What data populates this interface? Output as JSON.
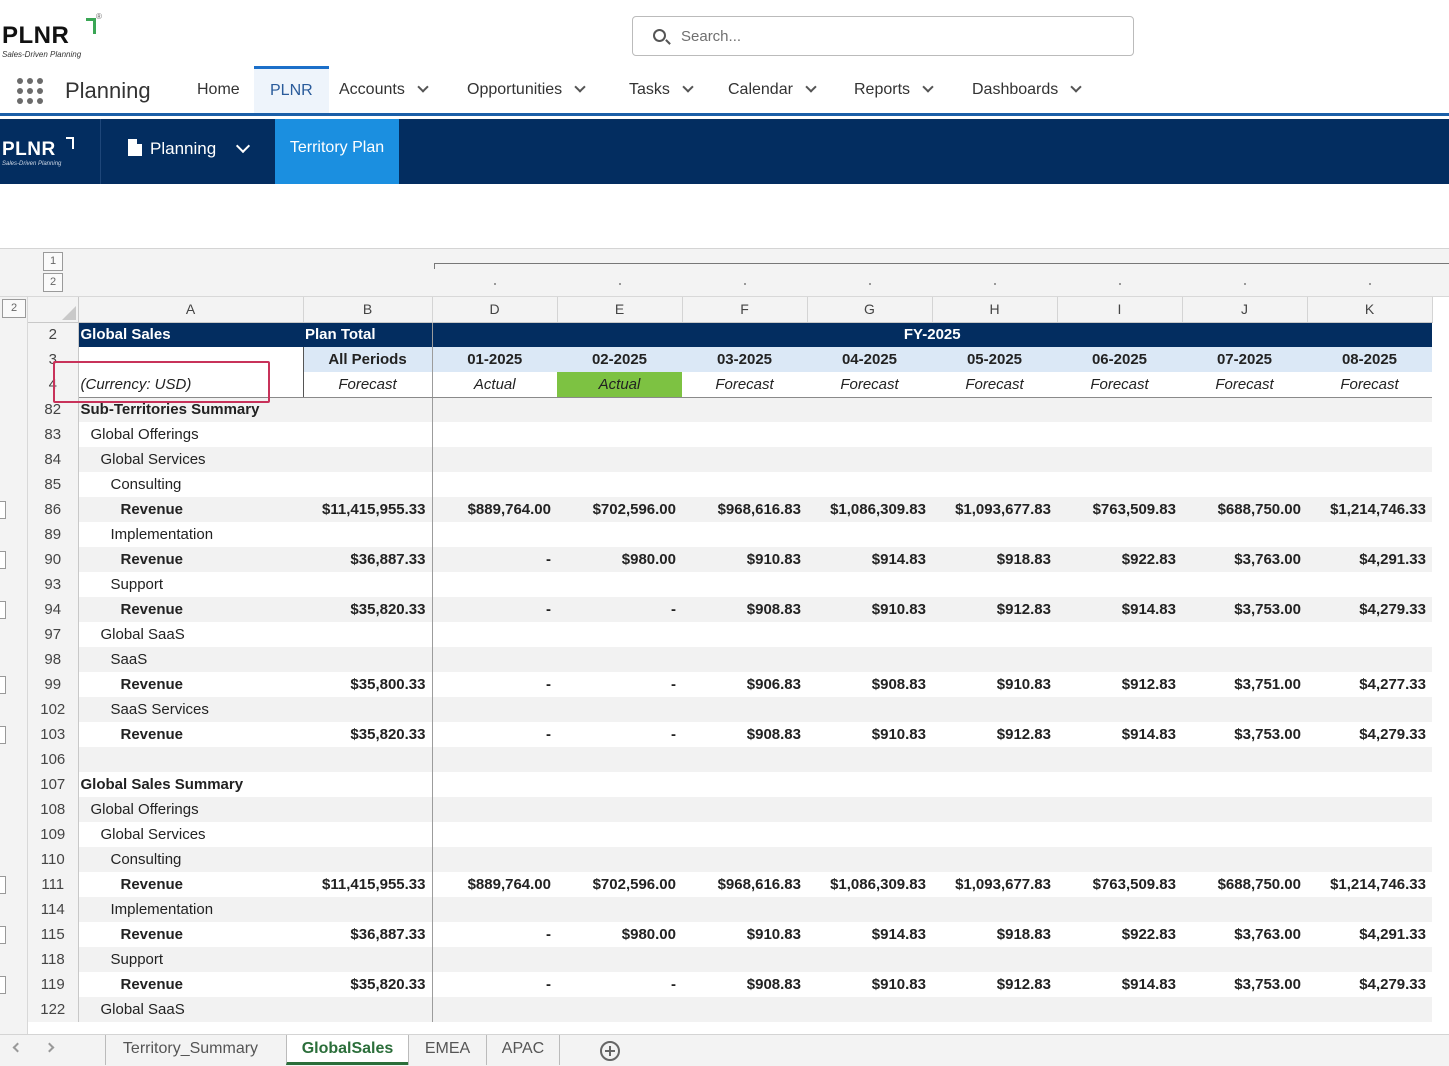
{
  "app": {
    "logo_text": "PLNR",
    "logo_tagline": "Sales-Driven Planning",
    "logo_reg": "®",
    "search_placeholder": "Search...",
    "app_name": "Planning"
  },
  "nav": {
    "items": [
      {
        "label": "Home",
        "dropdown": false,
        "active": false
      },
      {
        "label": "PLNR",
        "dropdown": false,
        "active": true
      },
      {
        "label": "Accounts",
        "dropdown": true,
        "active": false
      },
      {
        "label": "Opportunities",
        "dropdown": true,
        "active": false
      },
      {
        "label": "Tasks",
        "dropdown": true,
        "active": false
      },
      {
        "label": "Calendar",
        "dropdown": true,
        "active": false
      },
      {
        "label": "Reports",
        "dropdown": true,
        "active": false
      },
      {
        "label": "Dashboards",
        "dropdown": true,
        "active": false
      }
    ]
  },
  "subbar": {
    "logo_text": "PLNR",
    "logo_tagline": "Sales-Driven Planning",
    "planning_label": "Planning",
    "active_tab": "Territory Plan"
  },
  "sheet": {
    "outline_levels": [
      "1",
      "2"
    ],
    "columns": [
      "A",
      "B",
      "D",
      "E",
      "F",
      "G",
      "H",
      "I",
      "J",
      "K"
    ],
    "header_rows": {
      "r2": {
        "rn": "2",
        "a": "Global Sales",
        "b": "Plan Total",
        "fy": "FY-2025"
      },
      "r3": {
        "rn": "3",
        "b": "All Periods",
        "periods": [
          "01-2025",
          "02-2025",
          "03-2025",
          "04-2025",
          "05-2025",
          "06-2025",
          "07-2025",
          "08-2025"
        ]
      },
      "r4": {
        "rn": "4",
        "a": "(Currency: USD)",
        "b": "Forecast",
        "types": [
          "Actual",
          "Actual",
          "Forecast",
          "Forecast",
          "Forecast",
          "Forecast",
          "Forecast",
          "Forecast"
        ]
      }
    },
    "rows": [
      {
        "rn": "82",
        "label": "Sub-Territories Summary",
        "level": 0,
        "bold": true,
        "values": null
      },
      {
        "rn": "83",
        "label": "Global Offerings",
        "level": 1,
        "bold": false,
        "values": null
      },
      {
        "rn": "84",
        "label": "Global Services",
        "level": 2,
        "bold": false,
        "values": null
      },
      {
        "rn": "85",
        "label": "Consulting",
        "level": 3,
        "bold": false,
        "values": null
      },
      {
        "rn": "86",
        "label": "Revenue",
        "level": 4,
        "bold": true,
        "total": "$11,415,955.33",
        "values": [
          "$889,764.00",
          "$702,596.00",
          "$968,616.83",
          "$1,086,309.83",
          "$1,093,677.83",
          "$763,509.83",
          "$688,750.00",
          "$1,214,746.33"
        ]
      },
      {
        "rn": "89",
        "label": "Implementation",
        "level": 3,
        "bold": false,
        "values": null
      },
      {
        "rn": "90",
        "label": "Revenue",
        "level": 4,
        "bold": true,
        "total": "$36,887.33",
        "values": [
          "-",
          "$980.00",
          "$910.83",
          "$914.83",
          "$918.83",
          "$922.83",
          "$3,763.00",
          "$4,291.33"
        ]
      },
      {
        "rn": "93",
        "label": "Support",
        "level": 3,
        "bold": false,
        "values": null
      },
      {
        "rn": "94",
        "label": "Revenue",
        "level": 4,
        "bold": true,
        "total": "$35,820.33",
        "values": [
          "-",
          "-",
          "$908.83",
          "$910.83",
          "$912.83",
          "$914.83",
          "$3,753.00",
          "$4,279.33"
        ]
      },
      {
        "rn": "97",
        "label": "Global SaaS",
        "level": 2,
        "bold": false,
        "values": null
      },
      {
        "rn": "98",
        "label": "SaaS",
        "level": 3,
        "bold": false,
        "values": null
      },
      {
        "rn": "99",
        "label": "Revenue",
        "level": 4,
        "bold": true,
        "total": "$35,800.33",
        "values": [
          "-",
          "-",
          "$906.83",
          "$908.83",
          "$910.83",
          "$912.83",
          "$3,751.00",
          "$4,277.33"
        ]
      },
      {
        "rn": "102",
        "label": "SaaS Services",
        "level": 3,
        "bold": false,
        "values": null
      },
      {
        "rn": "103",
        "label": "Revenue",
        "level": 4,
        "bold": true,
        "total": "$35,820.33",
        "values": [
          "-",
          "-",
          "$908.83",
          "$910.83",
          "$912.83",
          "$914.83",
          "$3,753.00",
          "$4,279.33"
        ]
      },
      {
        "rn": "106",
        "label": "",
        "level": 0,
        "bold": false,
        "values": null
      },
      {
        "rn": "107",
        "label": "Global Sales Summary",
        "level": 0,
        "bold": true,
        "values": null
      },
      {
        "rn": "108",
        "label": "Global Offerings",
        "level": 1,
        "bold": false,
        "values": null
      },
      {
        "rn": "109",
        "label": "Global Services",
        "level": 2,
        "bold": false,
        "values": null
      },
      {
        "rn": "110",
        "label": "Consulting",
        "level": 3,
        "bold": false,
        "values": null
      },
      {
        "rn": "111",
        "label": "Revenue",
        "level": 4,
        "bold": true,
        "total": "$11,415,955.33",
        "values": [
          "$889,764.00",
          "$702,596.00",
          "$968,616.83",
          "$1,086,309.83",
          "$1,093,677.83",
          "$763,509.83",
          "$688,750.00",
          "$1,214,746.33"
        ]
      },
      {
        "rn": "114",
        "label": "Implementation",
        "level": 3,
        "bold": false,
        "values": null
      },
      {
        "rn": "115",
        "label": "Revenue",
        "level": 4,
        "bold": true,
        "total": "$36,887.33",
        "values": [
          "-",
          "$980.00",
          "$910.83",
          "$914.83",
          "$918.83",
          "$922.83",
          "$3,763.00",
          "$4,291.33"
        ]
      },
      {
        "rn": "118",
        "label": "Support",
        "level": 3,
        "bold": false,
        "values": null
      },
      {
        "rn": "119",
        "label": "Revenue",
        "level": 4,
        "bold": true,
        "total": "$35,820.33",
        "values": [
          "-",
          "-",
          "$908.83",
          "$910.83",
          "$912.83",
          "$914.83",
          "$3,753.00",
          "$4,279.33"
        ]
      },
      {
        "rn": "122",
        "label": "Global SaaS",
        "level": 2,
        "bold": false,
        "values": null
      }
    ],
    "tabs": [
      {
        "label": "Territory_Summary",
        "active": false
      },
      {
        "label": "GlobalSales",
        "active": true
      },
      {
        "label": "EMEA",
        "active": false
      },
      {
        "label": "APAC",
        "active": false
      }
    ]
  },
  "colors": {
    "brand_navy": "#032d60",
    "accent_blue": "#1b8fe0",
    "actual_green": "#7dc242",
    "highlight_red": "#c8325a"
  }
}
